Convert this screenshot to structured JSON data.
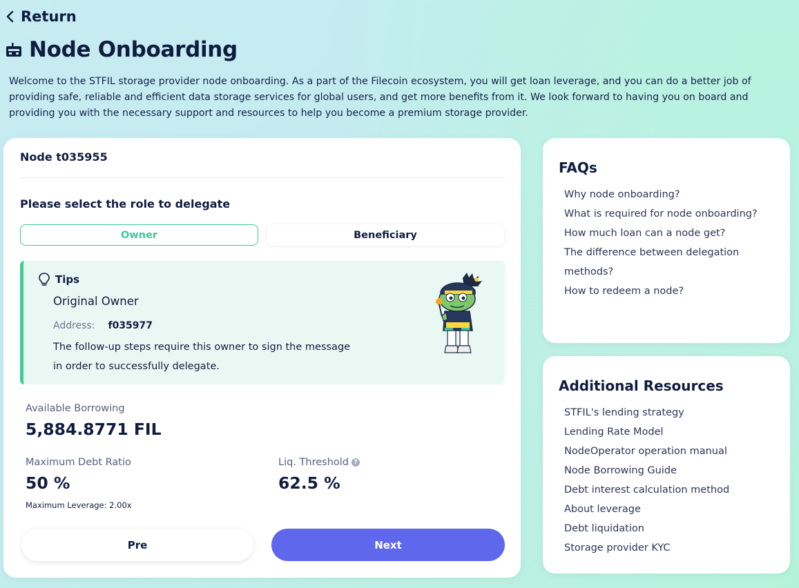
{
  "header": {
    "return_label": "Return",
    "title": "Node Onboarding",
    "intro": "Welcome to the STFIL storage provider node onboarding. As a part of the Filecoin ecosystem, you will get loan leverage, and you can do a better job of providing safe, reliable and efficient data storage services for global users, and get more benefits from it. We look forward to having you on board and providing you with the necessary support and resources to help you become a premium storage provider."
  },
  "main": {
    "node_title": "Node t035955",
    "select_label": "Please select the role to delegate",
    "roles": [
      {
        "label": "Owner",
        "selected": true
      },
      {
        "label": "Beneficiary",
        "selected": false
      }
    ],
    "tips": {
      "heading": "Tips",
      "role_title": "Original Owner",
      "address_label": "Address:",
      "address_value": "f035977",
      "description": "The follow-up steps require this owner to sign the message in order to successfully delegate."
    },
    "available_borrowing_label": "Available Borrowing",
    "available_borrowing_value": "5,884.8771 FIL",
    "max_debt_ratio_label": "Maximum Debt Ratio",
    "max_debt_ratio_value": "50 %",
    "max_leverage": "Maximum Leverage: 2.00x",
    "liq_threshold_label": "Liq. Threshold",
    "liq_threshold_value": "62.5 %",
    "pre_label": "Pre",
    "next_label": "Next"
  },
  "faq": {
    "title": "FAQs",
    "items": [
      "Why node onboarding?",
      "What is required for node onboarding?",
      "How much loan can a node get?",
      "The difference between delegation methods?",
      "How to redeem a node?"
    ]
  },
  "resources": {
    "title": "Additional Resources",
    "items": [
      "STFIL's lending strategy",
      "Lending Rate Model",
      "NodeOperator operation manual",
      "Node Borrowing Guide",
      "Debt interest calculation method",
      "About leverage",
      "Debt liquidation",
      "Storage provider KYC"
    ]
  },
  "icons": {
    "return": "chevron-left-icon",
    "title": "node-server-icon",
    "tips": "lightbulb-icon",
    "help": "question-circle-icon"
  },
  "colors": {
    "accent_green": "#3cc79a",
    "next_button": "#5f67ec",
    "tips_background": "#eaf8f4",
    "text_dark": "#0f1c3f"
  }
}
